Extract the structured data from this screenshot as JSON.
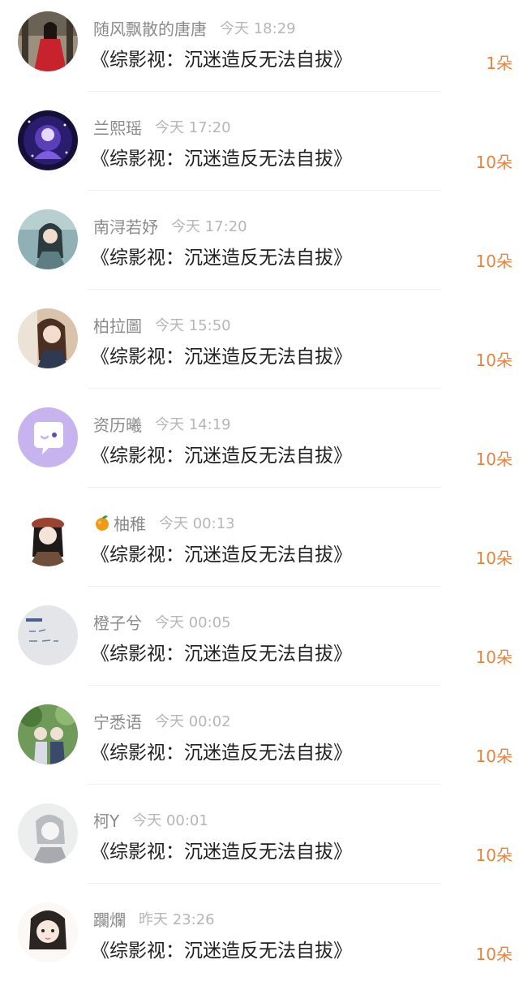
{
  "colors": {
    "name": "#8a8a8a",
    "time": "#b6b6b6",
    "book_title": "#1f1f1f",
    "amount": "#e6843f",
    "divider": "#f0f0f0"
  },
  "entries": [
    {
      "name": "随风飘散的唐唐",
      "time": "今天 18:29",
      "book": "《综影视：沉迷造反无法自拔》",
      "amount": "1朵",
      "avatar_icon": "avatar-girl-red-dress-icon"
    },
    {
      "name": "兰熙瑶",
      "time": "今天 17:20",
      "book": "《综影视：沉迷造反无法自拔》",
      "amount": "10朵",
      "avatar_icon": "avatar-galaxy-anime-icon"
    },
    {
      "name": "南浔若妤",
      "time": "今天 17:20",
      "book": "《综影视：沉迷造反无法自拔》",
      "amount": "10朵",
      "avatar_icon": "avatar-ancient-style-girl-icon"
    },
    {
      "name": "柏拉圖",
      "time": "今天 15:50",
      "book": "《综影视：沉迷造反无法自拔》",
      "amount": "10朵",
      "avatar_icon": "avatar-girl-portrait-icon"
    },
    {
      "name": "资历曦",
      "time": "今天 14:19",
      "book": "《综影视：沉迷造反无法自拔》",
      "amount": "10朵",
      "avatar_icon": "avatar-default-chat-bubble-icon"
    },
    {
      "name": "柚稚",
      "time": "今天 00:13",
      "book": "《综影视：沉迷造反无法自拔》",
      "amount": "10朵",
      "avatar_icon": "avatar-girl-beret-icon",
      "name_prefix_icon": "tangerine-emoji-icon"
    },
    {
      "name": "橙子兮",
      "time": "今天 00:05",
      "book": "《综影视：沉迷造反无法自拔》",
      "amount": "10朵",
      "avatar_icon": "avatar-handwriting-note-icon"
    },
    {
      "name": "宁悉语",
      "time": "今天 00:02",
      "book": "《综影视：沉迷造反无法自拔》",
      "amount": "10朵",
      "avatar_icon": "avatar-couple-forest-icon"
    },
    {
      "name": "柯Y",
      "time": "今天 00:01",
      "book": "《综影视：沉迷造反无法自拔》",
      "amount": "10朵",
      "avatar_icon": "avatar-grey-anime-icon"
    },
    {
      "name": "躝爛",
      "time": "昨天 23:26",
      "book": "《综影视：沉迷造反无法自拔》",
      "amount": "10朵",
      "avatar_icon": "avatar-girl-sketch-icon"
    }
  ]
}
